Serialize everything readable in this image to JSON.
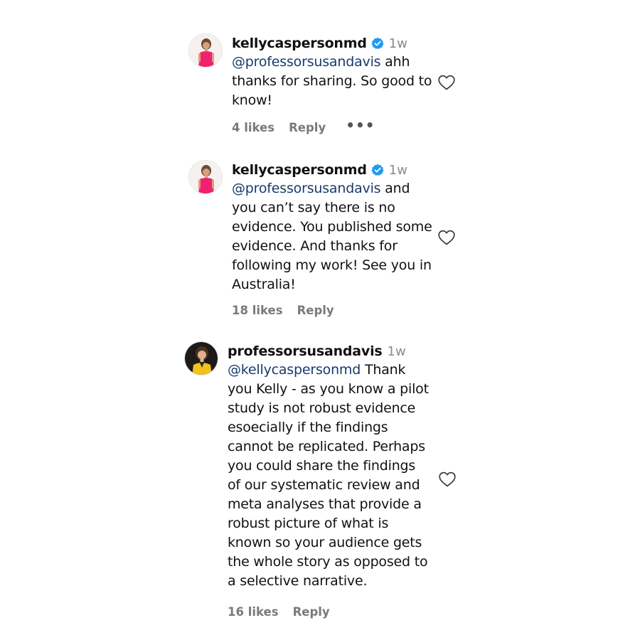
{
  "colors": {
    "mention": "#1a3a6b",
    "verified": "#1d9bf0",
    "meta": "#7a7a7a",
    "time": "#8a8a8a"
  },
  "comments": [
    {
      "username": "kellycaspersonmd",
      "verified": true,
      "time": "1w",
      "mention": "@professorsusandavis",
      "lines": [
        " ahh",
        "thanks for sharing. So good to",
        "know!"
      ],
      "likes": "4 likes",
      "reply": "Reply",
      "more": "•••",
      "avatar_icon": "avatar-pink-dress"
    },
    {
      "username": "kellycaspersonmd",
      "verified": true,
      "time": "1w",
      "mention": "@professorsusandavis",
      "lines": [
        " and",
        "you can’t say there is no",
        "evidence. You published some",
        "evidence. And thanks for",
        "following my work! See you in",
        "Australia!"
      ],
      "likes": "18 likes",
      "reply": "Reply",
      "avatar_icon": "avatar-pink-dress"
    },
    {
      "username": "professorsusandavis",
      "verified": false,
      "time": "1w",
      "mention": "@kellycaspersonmd",
      "lines": [
        " Thank",
        "you Kelly - as you know a pilot",
        "study is not robust evidence",
        "esoecially if the findings",
        "cannot be replicated. Perhaps",
        "you could share the findings",
        "of our systematic review and",
        "meta analyses that provide a",
        "robust picture of what is",
        "known so your audience gets",
        "the whole story as opposed to",
        "a selective narrative."
      ],
      "likes": "16 likes",
      "reply": "Reply",
      "avatar_icon": "avatar-yellow-jacket"
    }
  ]
}
